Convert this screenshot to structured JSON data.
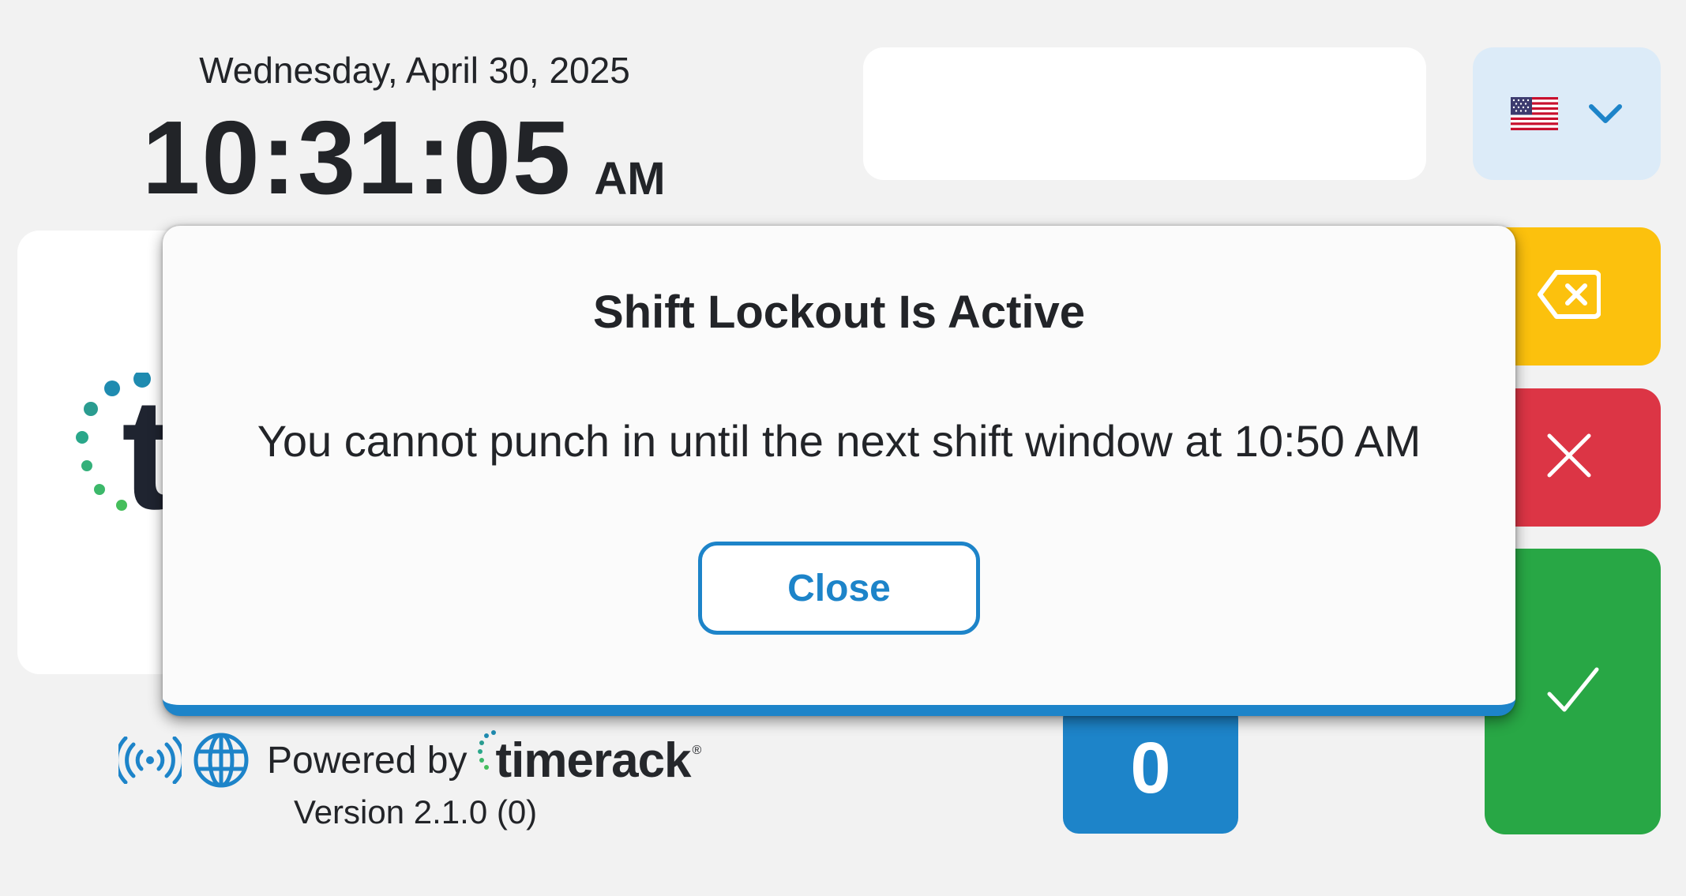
{
  "header": {
    "date": "Wednesday, April 30, 2025",
    "time": "10:31:05",
    "ampm": "AM",
    "pin_value": ""
  },
  "language": {
    "selected_flag": "us-flag",
    "icon": "chevron-down-icon"
  },
  "keypad": {
    "zero_label": "0",
    "backspace_icon": "backspace-icon",
    "clear_icon": "close-x-icon",
    "submit_icon": "checkmark-icon",
    "colors": {
      "backspace": "#fcc10d",
      "clear": "#dc3545",
      "submit": "#28a745",
      "digit": "#1d84c9"
    }
  },
  "footer": {
    "powered_by": "Powered by",
    "brand": "timerack",
    "brand_reg": "®",
    "version": "Version 2.1.0 (0)",
    "icons": [
      "wireless-signal-icon",
      "globe-icon"
    ]
  },
  "modal": {
    "title": "Shift Lockout Is Active",
    "message": "You cannot punch in until the next shift window at 10:50 AM",
    "close_label": "Close",
    "accent_color": "#1d84c9"
  }
}
